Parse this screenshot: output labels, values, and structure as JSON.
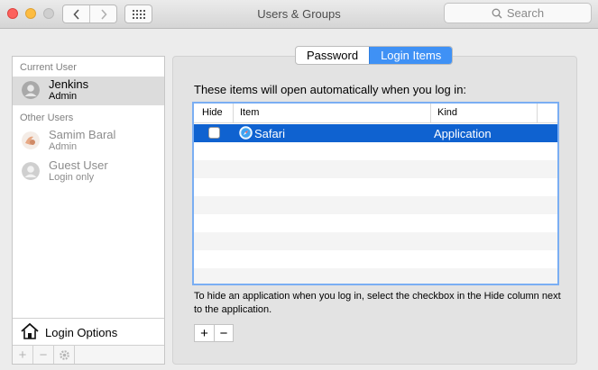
{
  "window": {
    "title": "Users & Groups"
  },
  "search": {
    "placeholder": "Search"
  },
  "sidebar": {
    "current_user_label": "Current User",
    "current_user": {
      "name": "Jenkins",
      "role": "Admin"
    },
    "other_users_label": "Other Users",
    "other_users": [
      {
        "name": "Samim Baral",
        "role": "Admin"
      },
      {
        "name": "Guest User",
        "role": "Login only"
      }
    ],
    "login_options_label": "Login Options",
    "tools": [
      "+",
      "−",
      "gear-icon"
    ]
  },
  "tabs": [
    {
      "label": "Password",
      "active": false
    },
    {
      "label": "Login Items",
      "active": true
    }
  ],
  "login_items": {
    "intro": "These items will open automatically when you log in:",
    "columns": {
      "hide": "Hide",
      "item": "Item",
      "kind": "Kind"
    },
    "rows": [
      {
        "hide": false,
        "item": "Safari",
        "kind": "Application",
        "icon": "safari-icon",
        "selected": true
      }
    ],
    "hint": "To hide an application when you log in, select the checkbox in the Hide column next to the application.",
    "add_label": "+",
    "remove_label": "−"
  },
  "colors": {
    "selection": "#0f62d0",
    "accent": "#3f91f5",
    "close": "#fc615d",
    "minimize": "#fdbc40"
  }
}
